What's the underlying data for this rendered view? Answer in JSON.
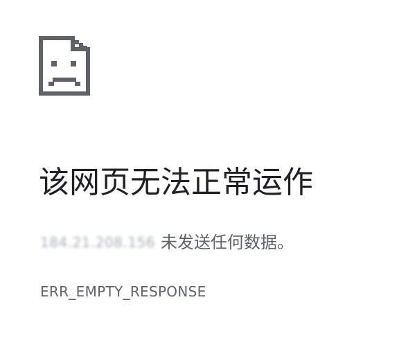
{
  "icon": "sad-page-icon",
  "heading": "该网页无法正常运作",
  "message": {
    "host": "184.21.208.156",
    "text": "未发送任何数据。"
  },
  "error_code": "ERR_EMPTY_RESPONSE",
  "colors": {
    "heading": "#202124",
    "body": "#5f6368",
    "icon": "#5f6368"
  }
}
